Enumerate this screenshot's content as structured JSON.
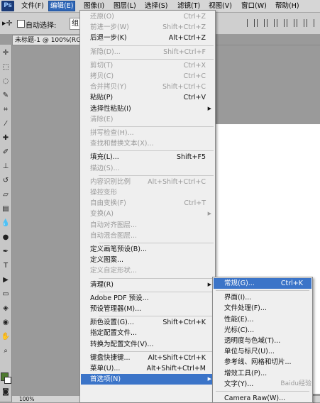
{
  "menubar": {
    "logo": "Ps",
    "items": [
      {
        "label": "文件(F)",
        "active": false
      },
      {
        "label": "编辑(E)",
        "active": true
      },
      {
        "label": "图像(I)",
        "active": false
      },
      {
        "label": "图层(L)",
        "active": false
      },
      {
        "label": "选择(S)",
        "active": false
      },
      {
        "label": "滤镜(T)",
        "active": false
      },
      {
        "label": "视图(V)",
        "active": false
      },
      {
        "label": "窗口(W)",
        "active": false
      },
      {
        "label": "帮助(H)",
        "active": false
      }
    ],
    "window_controls": [
      "▭",
      "─",
      "✕"
    ]
  },
  "options_bar": {
    "auto_select_label": "自动选择:",
    "group_value": "组"
  },
  "document_tab": {
    "title": "未标题-1 @ 100%(RGB/8)"
  },
  "status": {
    "zoom": "100%"
  },
  "edit_menu": {
    "items": [
      {
        "label": "还原(O)",
        "shortcut": "Ctrl+Z",
        "disabled": true
      },
      {
        "label": "前进一步(W)",
        "shortcut": "Shift+Ctrl+Z",
        "disabled": true
      },
      {
        "label": "后退一步(K)",
        "shortcut": "Alt+Ctrl+Z",
        "disabled": false
      },
      {
        "sep": true
      },
      {
        "label": "渐隐(D)...",
        "shortcut": "Shift+Ctrl+F",
        "disabled": true
      },
      {
        "sep": true
      },
      {
        "label": "剪切(T)",
        "shortcut": "Ctrl+X",
        "disabled": true
      },
      {
        "label": "拷贝(C)",
        "shortcut": "Ctrl+C",
        "disabled": true
      },
      {
        "label": "合并拷贝(Y)",
        "shortcut": "Shift+Ctrl+C",
        "disabled": true
      },
      {
        "label": "粘贴(P)",
        "shortcut": "Ctrl+V",
        "disabled": false
      },
      {
        "label": "选择性粘贴(I)",
        "shortcut": "",
        "disabled": false,
        "submenu": true
      },
      {
        "label": "清除(E)",
        "shortcut": "",
        "disabled": true
      },
      {
        "sep": true
      },
      {
        "label": "拼写检查(H)...",
        "shortcut": "",
        "disabled": true
      },
      {
        "label": "查找和替换文本(X)...",
        "shortcut": "",
        "disabled": true
      },
      {
        "sep": true
      },
      {
        "label": "填充(L)...",
        "shortcut": "Shift+F5",
        "disabled": false
      },
      {
        "label": "描边(S)...",
        "shortcut": "",
        "disabled": true
      },
      {
        "sep": true
      },
      {
        "label": "内容识别比例",
        "shortcut": "Alt+Shift+Ctrl+C",
        "disabled": true
      },
      {
        "label": "操控变形",
        "shortcut": "",
        "disabled": true
      },
      {
        "label": "自由变换(F)",
        "shortcut": "Ctrl+T",
        "disabled": true
      },
      {
        "label": "变换(A)",
        "shortcut": "",
        "disabled": true,
        "submenu": true
      },
      {
        "label": "自动对齐图层...",
        "shortcut": "",
        "disabled": true
      },
      {
        "label": "自动混合图层...",
        "shortcut": "",
        "disabled": true
      },
      {
        "sep": true
      },
      {
        "label": "定义画笔预设(B)...",
        "shortcut": "",
        "disabled": false
      },
      {
        "label": "定义图案...",
        "shortcut": "",
        "disabled": false
      },
      {
        "label": "定义自定形状...",
        "shortcut": "",
        "disabled": true
      },
      {
        "sep": true
      },
      {
        "label": "清理(R)",
        "shortcut": "",
        "disabled": false,
        "submenu": true
      },
      {
        "sep": true
      },
      {
        "label": "Adobe PDF 预设...",
        "shortcut": "",
        "disabled": false
      },
      {
        "label": "预设管理器(M)...",
        "shortcut": "",
        "disabled": false
      },
      {
        "sep": true
      },
      {
        "label": "颜色设置(G)...",
        "shortcut": "Shift+Ctrl+K",
        "disabled": false
      },
      {
        "label": "指定配置文件...",
        "shortcut": "",
        "disabled": false
      },
      {
        "label": "转换为配置文件(V)...",
        "shortcut": "",
        "disabled": false
      },
      {
        "sep": true
      },
      {
        "label": "键盘快捷键...",
        "shortcut": "Alt+Shift+Ctrl+K",
        "disabled": false
      },
      {
        "label": "菜单(U)...",
        "shortcut": "Alt+Shift+Ctrl+M",
        "disabled": false
      },
      {
        "label": "首选项(N)",
        "shortcut": "",
        "disabled": false,
        "submenu": true,
        "highlighted": true
      }
    ]
  },
  "prefs_submenu": {
    "items": [
      {
        "label": "常规(G)...",
        "shortcut": "Ctrl+K",
        "highlighted": true
      },
      {
        "sep": true
      },
      {
        "label": "界面(I)..."
      },
      {
        "label": "文件处理(F)..."
      },
      {
        "label": "性能(E)..."
      },
      {
        "label": "光标(C)..."
      },
      {
        "label": "透明度与色域(T)..."
      },
      {
        "label": "单位与标尺(U)..."
      },
      {
        "label": "参考线、网格和切片..."
      },
      {
        "label": "增效工具(P)..."
      },
      {
        "label": "文字(Y)..."
      },
      {
        "sep": true
      },
      {
        "label": "Camera Raw(W)..."
      }
    ]
  },
  "watermark": "Baidu经验",
  "colors": {
    "highlight": "#3b74c8",
    "foreground_swatch": "#4e7a2f"
  }
}
